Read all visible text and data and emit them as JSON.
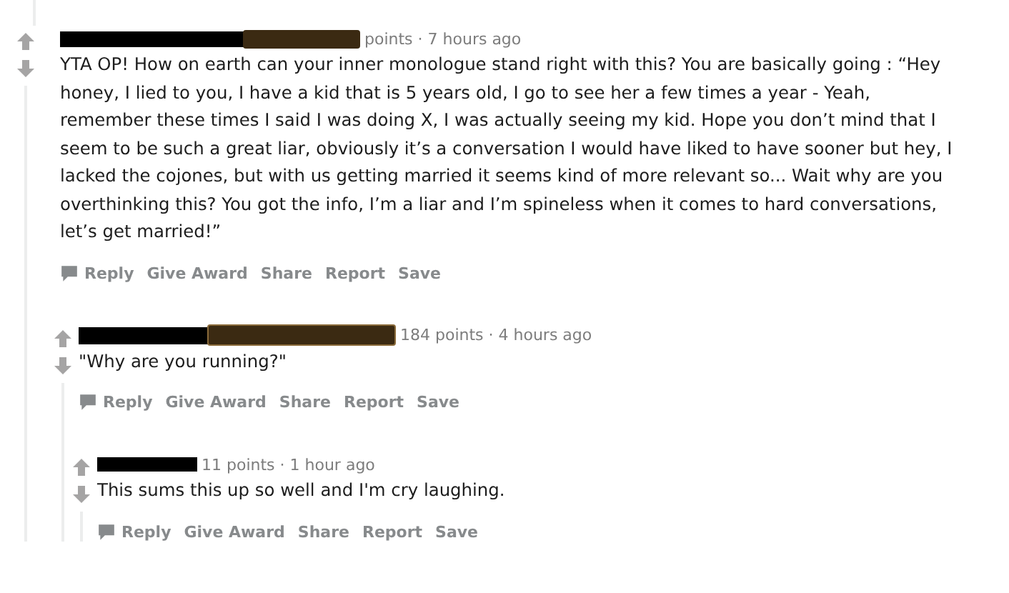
{
  "comments": [
    {
      "flair": true,
      "meta": "points · 7 hours ago",
      "body": "YTA OP! How on earth can your inner monologue stand right with this? You are basically going : “Hey honey, I lied to you, I have a kid that is 5 years old, I go to see her a few times a year - Yeah, remember these times I said I was doing X, I was actually seeing my kid. Hope you don’t mind that I seem to be such a great liar, obviously it’s a conversation I would have liked to have sooner but hey, I lacked the cojones, but with us getting married it seems kind of more relevant so... Wait why are you overthinking this? You got the info, I’m a liar and I’m spineless when it comes to hard conversations, let’s get married!”",
      "actions": [
        "Reply",
        "Give Award",
        "Share",
        "Report",
        "Save"
      ],
      "children": [
        {
          "flair": true,
          "meta": "184 points · 4 hours ago",
          "body": "\"Why are you running?\"",
          "actions": [
            "Reply",
            "Give Award",
            "Share",
            "Report",
            "Save"
          ],
          "children": [
            {
              "flair": false,
              "meta": "11 points · 1 hour ago",
              "body": "This sums this up so well and I'm cry laughing.",
              "actions": [
                "Reply",
                "Give Award",
                "Share",
                "Report",
                "Save"
              ]
            }
          ]
        }
      ]
    }
  ]
}
